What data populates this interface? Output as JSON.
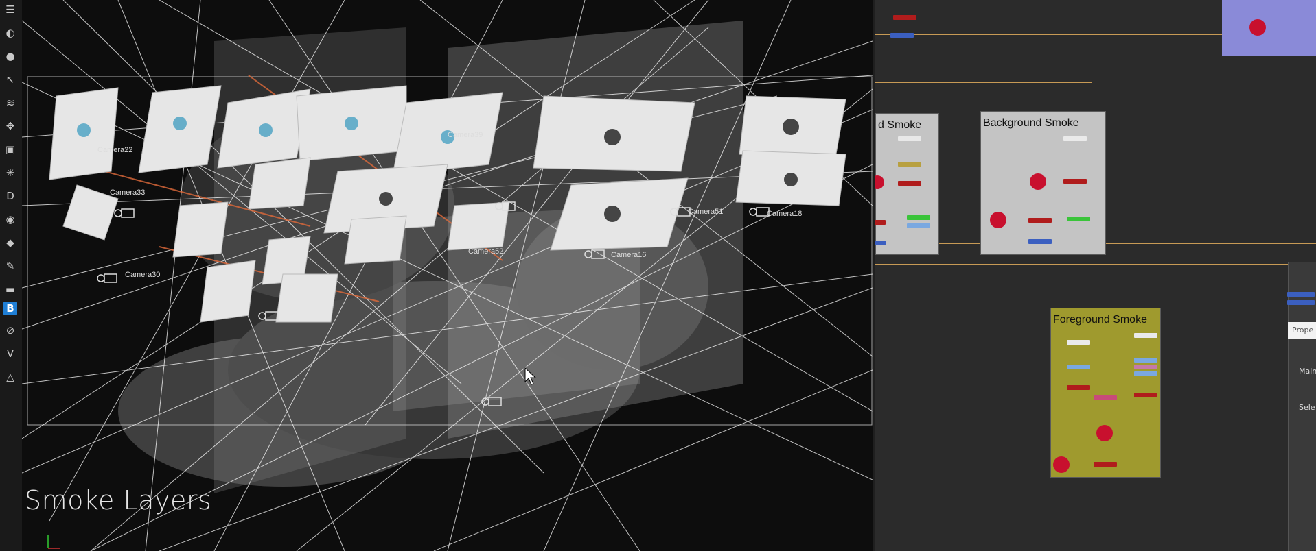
{
  "toolbar": {
    "icons": [
      "menu-icon",
      "sphere-icon",
      "circle-icon",
      "pointer-icon",
      "layers-icon",
      "move-icon",
      "cube-icon",
      "particles-icon",
      "d-badge-icon",
      "eye-icon",
      "tag-icon",
      "wrench-icon",
      "box-icon",
      "b-logo-icon",
      "compass-icon",
      "v-badge-icon",
      "triangle-logo-icon"
    ],
    "b_glyph": "B",
    "d_glyph": "D",
    "v_glyph": "V"
  },
  "viewport": {
    "overlay_title": "Smoke Layers",
    "camera_labels": [
      "Camera22",
      "Camera33",
      "Camera30",
      "Camera39",
      "Camera52",
      "Camera16",
      "Camera51",
      "Camera18"
    ],
    "colors": {
      "wire": "#ffffff",
      "plate": "#e6e6e6",
      "accent": "#e06a3a"
    }
  },
  "nodegraph": {
    "backdrops": [
      {
        "title": "d Smoke",
        "color": "#c4c4c4"
      },
      {
        "title": "Background Smoke",
        "color": "#c4c4c4"
      },
      {
        "title": "Foreground Smoke",
        "color": "#9f9a2e"
      }
    ],
    "top_right_node_color": "#8a8ad8",
    "wire_color": "#c79a55",
    "properties": {
      "tab_label": "Prope",
      "main_label": "Main",
      "select_label": "Sele"
    }
  }
}
